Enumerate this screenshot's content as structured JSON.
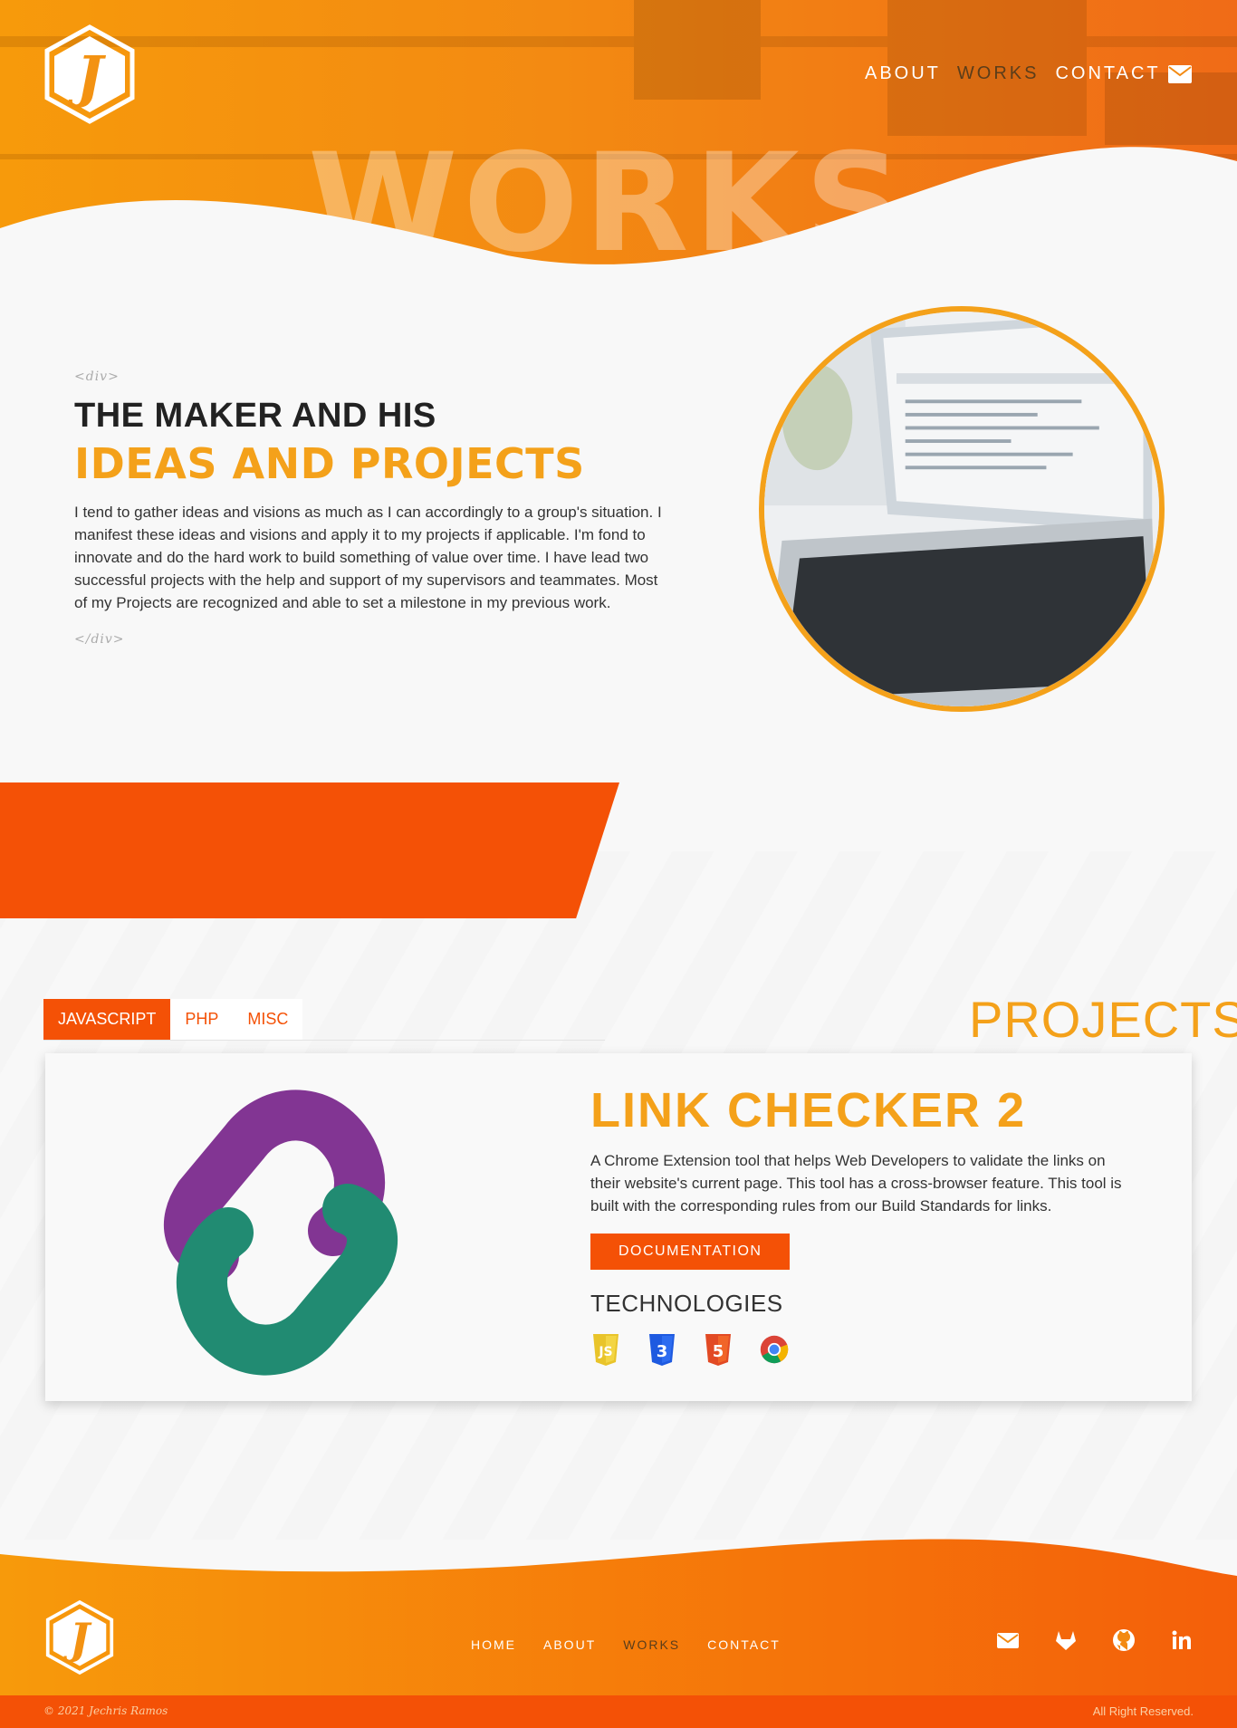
{
  "header": {
    "hero_word": "WORKS",
    "nav": [
      "ABOUT",
      "WORKS",
      "CONTACT"
    ],
    "active_nav": "WORKS"
  },
  "intro": {
    "tag_open": "<div>",
    "heading_light": "THE MAKER AND HIS",
    "heading_bold": "IDEAS AND PROJECTS",
    "text": "I tend to gather ideas and visions as much as I can accordingly to a group's situation. I manifest these ideas and visions and apply it to my projects if applicable. I'm fond to innovate and do the hard work to build something of value over time. I have lead two successful projects with the help and support of my supervisors and teammates. Most of my Projects are recognized and able to set a milestone in my previous work.",
    "tag_close": "</div>"
  },
  "projects": {
    "title": "PROJECTS",
    "tabs": [
      "JAVASCRIPT",
      "PHP",
      "MISC"
    ],
    "active_tab": "JAVASCRIPT",
    "card": {
      "title": "LINK CHECKER 2",
      "description": "A Chrome Extension tool that helps Web Developers to validate the links on their website's current page. This tool has a cross-browser feature. This tool is built with the corresponding rules from our Build Standards for links.",
      "button": "DOCUMENTATION",
      "tech_title": "TECHNOLOGIES",
      "tech_icons": [
        "javascript-icon",
        "css3-icon",
        "html5-icon",
        "chrome-icon"
      ]
    }
  },
  "footer": {
    "nav": [
      "HOME",
      "ABOUT",
      "WORKS",
      "CONTACT"
    ],
    "active_nav": "WORKS",
    "social": [
      "mail-icon",
      "gitlab-icon",
      "github-icon",
      "linkedin-icon"
    ],
    "copyright": "© 2021 Jechris Ramos",
    "rights": "All Right Reserved."
  },
  "colors": {
    "orange": "#f45106",
    "gold": "#f4a11a",
    "hero_start": "#f79a0b",
    "hero_end": "#f06b17"
  }
}
